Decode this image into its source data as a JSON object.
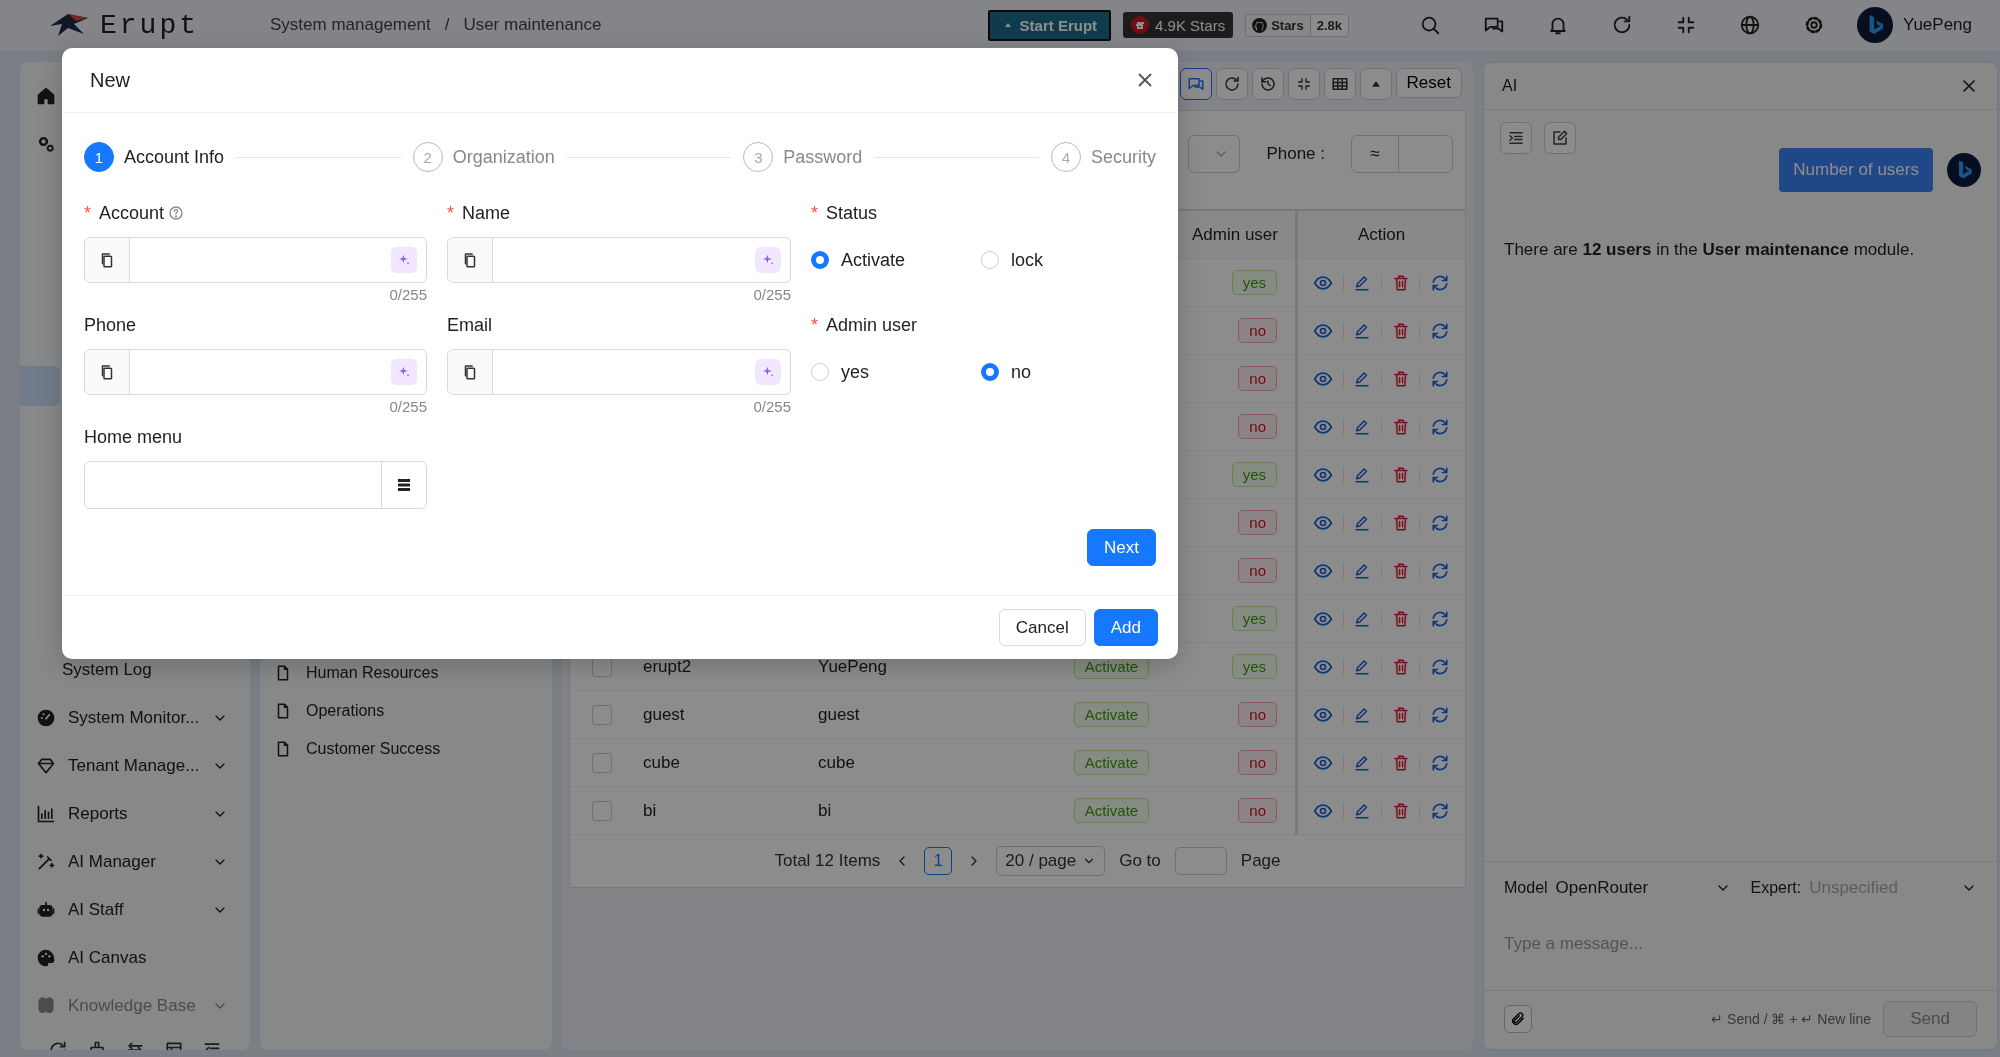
{
  "header": {
    "logo_text": "Erupt",
    "breadcrumb": [
      "System management",
      "User maintenance"
    ],
    "separator": "/",
    "start_button": "Start Erupt",
    "gitee_stars": "4.9K Stars",
    "github_label": "Stars",
    "github_count": "2.8k",
    "user_name": "YuePeng"
  },
  "sidebar": {
    "items": [
      {
        "kind": "icon-only"
      },
      {
        "kind": "icon-only"
      },
      {
        "kind": "highlight"
      },
      {
        "kind": "child",
        "label": "System Log",
        "faded": false
      },
      {
        "kind": "group",
        "label": "System Monitor...",
        "faded": false
      },
      {
        "kind": "group",
        "label": "Tenant Manage...",
        "faded": false
      },
      {
        "kind": "group",
        "label": "Reports",
        "faded": false
      },
      {
        "kind": "group",
        "label": "AI Manager",
        "faded": false
      },
      {
        "kind": "group",
        "label": "AI Staff",
        "faded": false
      },
      {
        "kind": "link",
        "label": "AI Canvas",
        "faded": false
      },
      {
        "kind": "group",
        "label": "Knowledge Base",
        "faded": true
      }
    ]
  },
  "tree": {
    "items": [
      "Human Resources",
      "Operations",
      "Customer Success"
    ]
  },
  "toolbar": {
    "chat_selected": true,
    "reset_button": "Reset"
  },
  "search": {
    "phone_label": "Phone :",
    "phone_operator": "≈"
  },
  "table": {
    "columns": [
      "Admin user",
      "Action"
    ],
    "rows": [
      {
        "admin_user": {
          "text": "yes",
          "kind": "positive"
        }
      },
      {
        "admin_user": {
          "text": "no",
          "kind": "negative"
        }
      },
      {
        "admin_user": {
          "text": "no",
          "kind": "negative"
        }
      },
      {
        "admin_user": {
          "text": "no",
          "kind": "negative"
        }
      },
      {
        "admin_user": {
          "text": "yes",
          "kind": "positive"
        }
      },
      {
        "admin_user": {
          "text": "no",
          "kind": "negative"
        }
      },
      {
        "admin_user": {
          "text": "no",
          "kind": "negative"
        }
      },
      {
        "admin_user": {
          "text": "yes",
          "kind": "positive"
        }
      },
      {
        "checked": false,
        "account": "erupt2",
        "name": "YuePeng",
        "status": {
          "text": "Activate",
          "kind": "positive"
        },
        "admin_user": {
          "text": "yes",
          "kind": "positive"
        }
      },
      {
        "checked": false,
        "account": "guest",
        "name": "guest",
        "status": {
          "text": "Activate",
          "kind": "positive"
        },
        "admin_user": {
          "text": "no",
          "kind": "negative"
        }
      },
      {
        "checked": false,
        "account": "cube",
        "name": "cube",
        "status": {
          "text": "Activate",
          "kind": "positive"
        },
        "admin_user": {
          "text": "no",
          "kind": "negative"
        }
      },
      {
        "checked": false,
        "account": "bi",
        "name": "bi",
        "status": {
          "text": "Activate",
          "kind": "positive"
        },
        "admin_user": {
          "text": "no",
          "kind": "negative"
        }
      }
    ]
  },
  "pagination": {
    "total": "Total 12 Items",
    "pages": [
      {
        "label": "1",
        "selected": true
      }
    ],
    "page_size": "20 / page",
    "goto_label": "Go to",
    "page_label": "Page"
  },
  "ai": {
    "title": "AI",
    "user_message": "Number of users",
    "reply": "There are **12 users** in the **User maintenance** module.",
    "model_label": "Model",
    "model_value": "OpenRouter",
    "expert_label": "Expert:",
    "expert_placeholder": "Unspecified",
    "input_placeholder": "Type a message...",
    "hint": "↵ Send / ⌘ + ↵ New line",
    "send_button": "Send",
    "send_disabled": true
  },
  "modal": {
    "title": "New",
    "steps": [
      {
        "number": "1",
        "label": "Account Info",
        "selected": true
      },
      {
        "number": "2",
        "label": "Organization",
        "selected": false
      },
      {
        "number": "3",
        "label": "Password",
        "selected": false
      },
      {
        "number": "4",
        "label": "Security",
        "selected": false
      }
    ],
    "fields": [
      {
        "kind": "text",
        "required_mark": "*",
        "label": "Account",
        "help": true,
        "counter": "0/255"
      },
      {
        "kind": "text",
        "required_mark": "*",
        "label": "Name",
        "help": false,
        "counter": "0/255"
      },
      {
        "kind": "radio",
        "required_mark": "*",
        "label": "Status",
        "options": [
          {
            "label": "Activate",
            "selected": true
          },
          {
            "label": "lock",
            "selected": false
          }
        ]
      },
      {
        "kind": "text",
        "label": "Phone",
        "help": false,
        "counter": "0/255"
      },
      {
        "kind": "text",
        "label": "Email",
        "help": false,
        "counter": "0/255"
      },
      {
        "kind": "radio",
        "required_mark": "*",
        "label": "Admin user",
        "options": [
          {
            "label": "yes",
            "selected": false
          },
          {
            "label": "no",
            "selected": true
          }
        ]
      },
      {
        "kind": "menu-select",
        "label": "Home menu"
      }
    ],
    "next_button": "Next",
    "cancel_button": "Cancel",
    "add_button": "Add"
  }
}
